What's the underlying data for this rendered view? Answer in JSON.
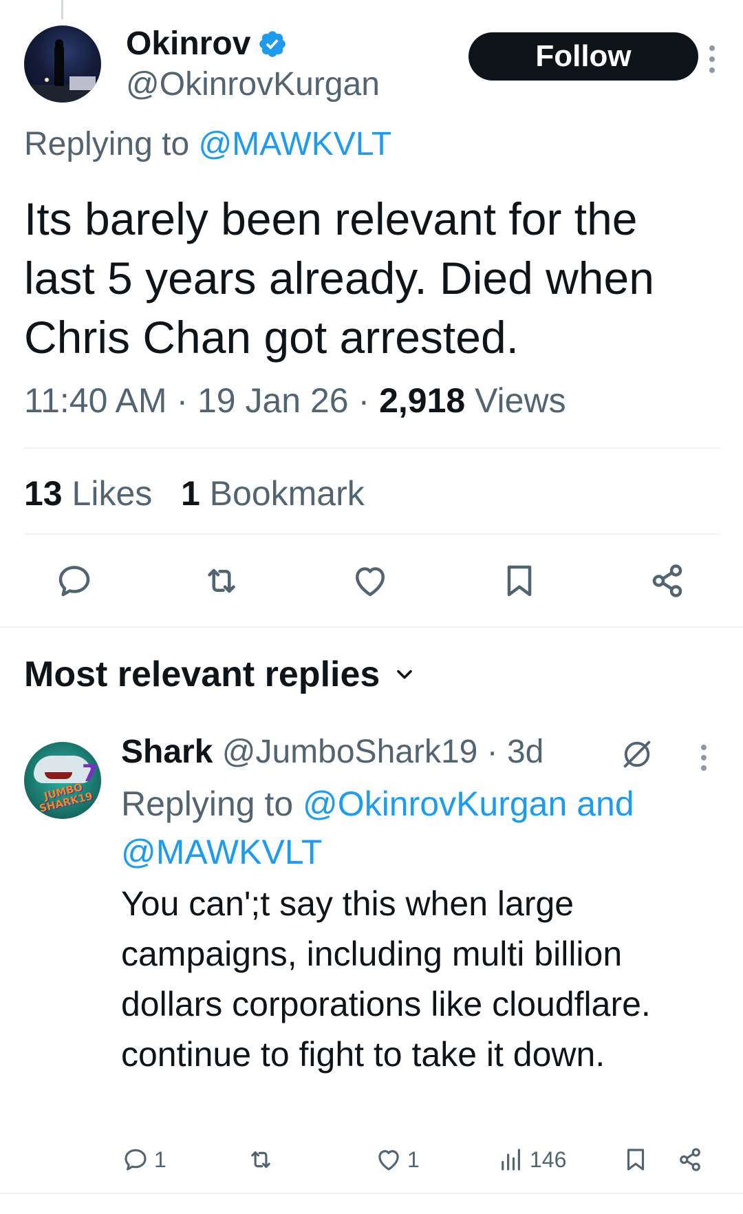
{
  "main_tweet": {
    "display_name": "Okinrov",
    "handle": "@OkinrovKurgan",
    "follow_label": "Follow",
    "replying_prefix": "Replying to ",
    "replying_to": "@MAWKVLT",
    "text": "Its barely been relevant for the last 5 years already. Died when Chris Chan got arrested.",
    "time": "11:40 AM",
    "date": "19 Jan 26",
    "views_count": "2,918",
    "views_label": "Views",
    "likes_count": "13",
    "likes_label": "Likes",
    "bookmarks_count": "1",
    "bookmarks_label": "Bookmark",
    "separator": " · "
  },
  "replies_section": {
    "title": "Most relevant replies"
  },
  "reply": {
    "display_name": "Shark",
    "handle": "@JumboShark19",
    "age": "3d",
    "replying_prefix": "Replying to ",
    "replying_to_1": "@OkinrovKurgan",
    "replying_and": " and ",
    "replying_to_2": "@MAWKVLT",
    "text": "You can';t say this when large campaigns, including multi billion dollars corporations like cloudflare. continue to fight to take it down.",
    "reply_count": "1",
    "like_count": "1",
    "view_count": "146",
    "avatar_text_1": "JUMBO",
    "avatar_text_2": "SHARK19",
    "avatar_badge": "7"
  },
  "colors": {
    "accent": "#1d9bf0",
    "text_primary": "#0f1419",
    "text_secondary": "#536471",
    "divider": "#eff3f4",
    "follow_bg": "#0f1419"
  },
  "icons": {
    "verified": "verified-badge-icon",
    "more": "more-vertical-icon",
    "reply": "reply-bubble-icon",
    "repost": "repost-icon",
    "like": "heart-icon",
    "bookmark": "bookmark-icon",
    "share": "share-icon",
    "chevron": "chevron-down-icon",
    "grok": "grok-icon",
    "views": "views-bar-chart-icon"
  }
}
